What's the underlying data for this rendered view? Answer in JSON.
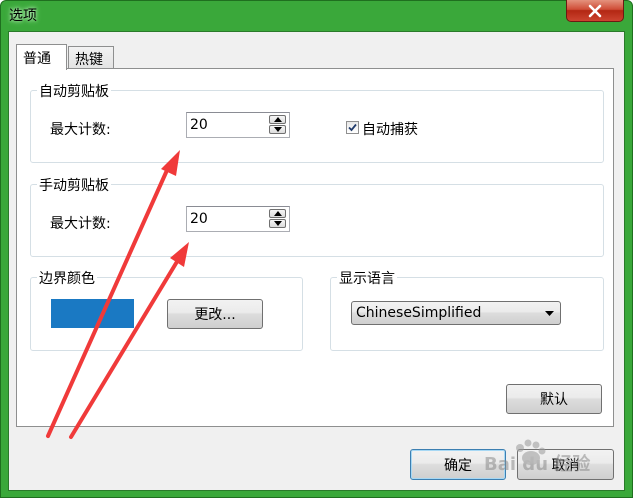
{
  "window": {
    "title": "选项"
  },
  "tabs": [
    {
      "label": "普通"
    },
    {
      "label": "热键"
    }
  ],
  "auto_clipboard": {
    "group_label": "自动剪贴板",
    "max_count_label": "最大计数:",
    "max_count_value": "20",
    "auto_capture_label": "自动捕获",
    "auto_capture_checked": true
  },
  "manual_clipboard": {
    "group_label": "手动剪贴板",
    "max_count_label": "最大计数:",
    "max_count_value": "20"
  },
  "border_color": {
    "group_label": "边界颜色",
    "color": "#1a79c3",
    "change_label": "更改..."
  },
  "display_language": {
    "group_label": "显示语言",
    "selected": "ChineseSimplified"
  },
  "buttons": {
    "default_label": "默认",
    "ok_label": "确定",
    "cancel_label": "取消"
  },
  "watermark": {
    "text": "Bai du 经验"
  },
  "colors": {
    "frame": "#3aa83a",
    "annotation_arrow": "#f03a3a",
    "close_button": "#c9412c"
  }
}
